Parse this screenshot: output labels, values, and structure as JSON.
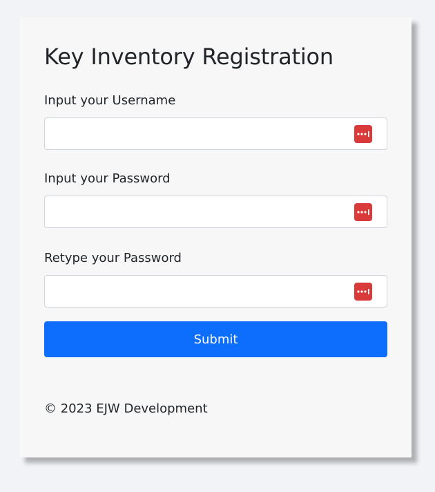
{
  "form": {
    "title": "Key Inventory Registration",
    "fields": [
      {
        "label": "Input your Username",
        "value": "",
        "placeholder": ""
      },
      {
        "label": "Input your Password",
        "value": "",
        "placeholder": ""
      },
      {
        "label": "Retype your Password",
        "value": "",
        "placeholder": ""
      }
    ],
    "submit_label": "Submit"
  },
  "footer": {
    "text": "© 2023 EJW Development"
  },
  "icons": {
    "field_icon": "password-manager-icon"
  },
  "colors": {
    "accent": "#0d6efd",
    "icon_red": "#d93b3b",
    "background": "#f2f3f7",
    "card": "#f7f7f7"
  }
}
